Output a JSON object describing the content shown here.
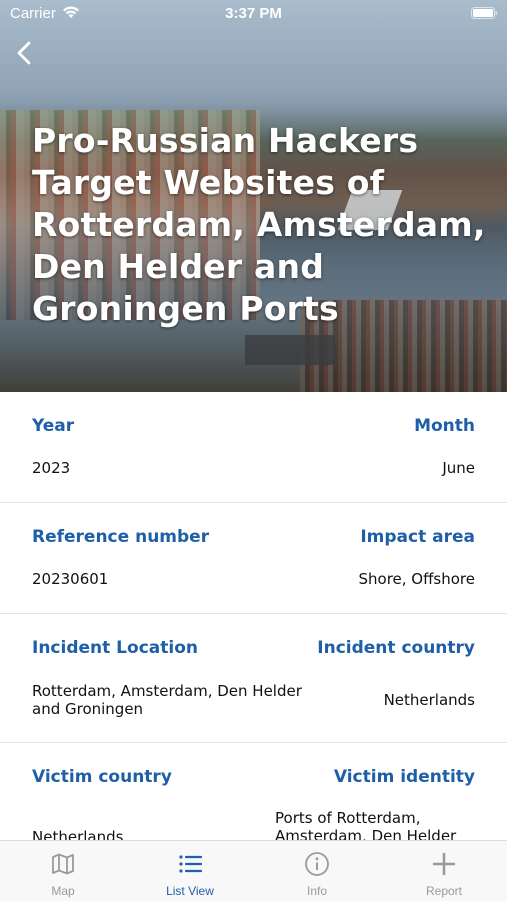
{
  "status_bar": {
    "carrier": "Carrier",
    "time": "3:37 PM"
  },
  "hero": {
    "title": "Pro-Russian Hackers Target Websites of Rotterdam, Amsterdam, Den Helder and Groningen Ports",
    "back_icon": "chevron-left-icon"
  },
  "details": {
    "year_label": "Year",
    "year": "2023",
    "month_label": "Month",
    "month": "June",
    "reference_label": "Reference number",
    "reference": "20230601",
    "impact_label": "Impact area",
    "impact": "Shore, Offshore",
    "location_label": "Incident Location",
    "location": "Rotterdam, Amsterdam, Den Helder and Groningen",
    "country_label": "Incident country",
    "country": "Netherlands",
    "victim_country_label": "Victim country",
    "victim_country": "Netherlands",
    "victim_identity_label": "Victim identity",
    "victim_identity": "Ports of Rotterdam, Amsterdam, Den Helder"
  },
  "tabbar": {
    "tabs": [
      {
        "label": "Map",
        "icon": "map-icon"
      },
      {
        "label": "List View",
        "icon": "list-icon"
      },
      {
        "label": "Info",
        "icon": "info-icon"
      },
      {
        "label": "Report",
        "icon": "plus-icon"
      }
    ],
    "active_color": "#1f5fa8",
    "inactive_color": "#9a9a9a"
  },
  "colors": {
    "label_blue": "#1f5fa8",
    "divider": "#e3e3e3"
  }
}
